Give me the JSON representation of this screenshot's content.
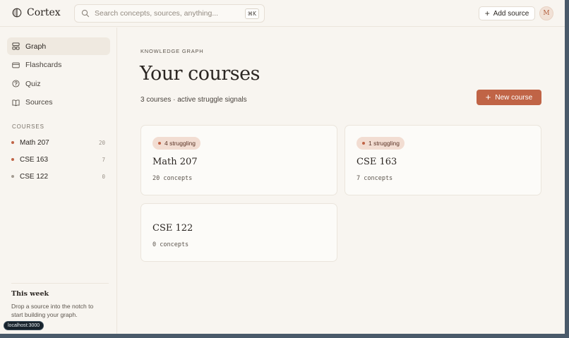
{
  "brand": {
    "name": "Cortex"
  },
  "search": {
    "placeholder": "Search concepts, sources, anything...",
    "shortcut": "⌘K"
  },
  "header": {
    "add_source_label": "Add source",
    "avatar_initial": "M"
  },
  "sidebar": {
    "nav": [
      {
        "label": "Graph",
        "icon": "graph-icon",
        "active": true
      },
      {
        "label": "Flashcards",
        "icon": "flashcards-icon",
        "active": false
      },
      {
        "label": "Quiz",
        "icon": "quiz-icon",
        "active": false
      },
      {
        "label": "Sources",
        "icon": "book-icon",
        "active": false
      }
    ],
    "courses_label": "COURSES",
    "courses": [
      {
        "name": "Math 207",
        "count": "20",
        "dot_color": "#c06446"
      },
      {
        "name": "CSE 163",
        "count": "7",
        "dot_color": "#c06446"
      },
      {
        "name": "CSE 122",
        "count": "0",
        "dot_color": "#a39b91"
      }
    ],
    "week": {
      "title": "This week",
      "text": "Drop a source into the notch to start building your graph."
    }
  },
  "main": {
    "eyebrow": "KNOWLEDGE GRAPH",
    "title": "Your courses",
    "subtitle": "3 courses · active struggle signals",
    "new_course_label": "New course",
    "cards": [
      {
        "badge": "4 struggling",
        "title": "Math 207",
        "meta": "20 concepts"
      },
      {
        "badge": "1 struggling",
        "title": "CSE 163",
        "meta": "7 concepts"
      },
      {
        "badge": null,
        "title": "CSE 122",
        "meta": "0 concepts"
      }
    ]
  },
  "dev": {
    "url": "localhost:3000"
  },
  "colors": {
    "accent": "#c06446",
    "background": "#f8f5f0",
    "badge_bg": "#f2ddd2"
  }
}
